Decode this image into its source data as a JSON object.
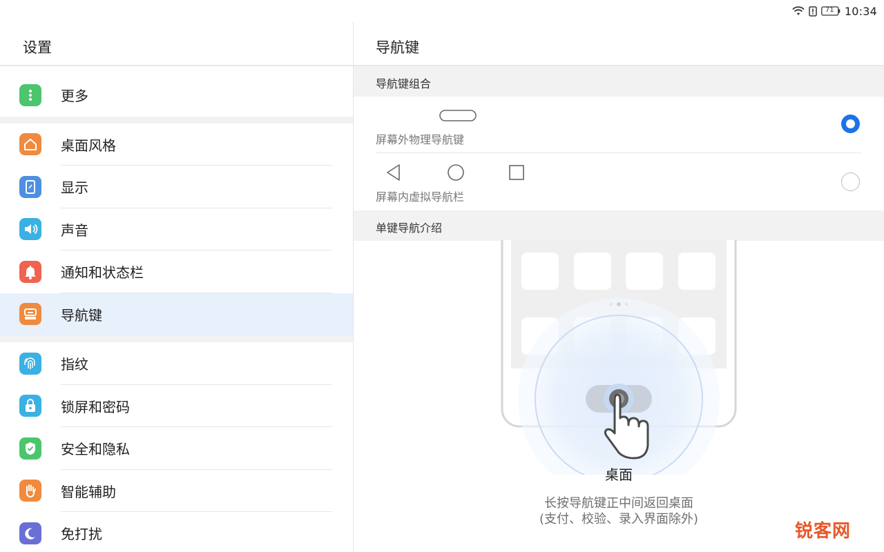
{
  "status_bar": {
    "battery_level": "71",
    "time": "10:34",
    "icons": [
      "wifi-icon",
      "alert-icon",
      "battery-icon"
    ]
  },
  "left_pane": {
    "title": "设置",
    "items": [
      {
        "label": "更多",
        "icon": "more-dots-icon",
        "color": "#4cc56d"
      },
      {
        "label": "桌面风格",
        "icon": "home-icon",
        "color": "#f08a3e"
      },
      {
        "label": "显示",
        "icon": "display-icon",
        "color": "#4d8fe0"
      },
      {
        "label": "声音",
        "icon": "speaker-icon",
        "color": "#3ab1e3"
      },
      {
        "label": "通知和状态栏",
        "icon": "bell-icon",
        "color": "#f0634f"
      },
      {
        "label": "导航键",
        "icon": "navigation-key-icon",
        "color": "#f08a3e",
        "selected": true
      },
      {
        "label": "指纹",
        "icon": "fingerprint-icon",
        "color": "#3ab1e3"
      },
      {
        "label": "锁屏和密码",
        "icon": "lock-icon",
        "color": "#3ab1e3"
      },
      {
        "label": "安全和隐私",
        "icon": "shield-icon",
        "color": "#4cc56d"
      },
      {
        "label": "智能辅助",
        "icon": "hand-icon",
        "color": "#f08a3e"
      },
      {
        "label": "免打扰",
        "icon": "moon-icon",
        "color": "#6a6fd6"
      }
    ]
  },
  "right_pane": {
    "title": "导航键",
    "section_combo": "导航键组合",
    "option_physical": "屏幕外物理导航键",
    "option_virtual": "屏幕内虚拟导航栏",
    "selected_option": "屏幕外物理导航键",
    "section_intro": "单键导航介绍",
    "illustration_title": "桌面",
    "illustration_line1": "长按导航键正中间返回桌面",
    "illustration_line2": "(支付、校验、录入界面除外)"
  },
  "watermark": "锐客网",
  "colors": {
    "accent": "#1a73e8",
    "selected_row": "#e8f0fb",
    "section_bg": "#f2f2f2"
  }
}
